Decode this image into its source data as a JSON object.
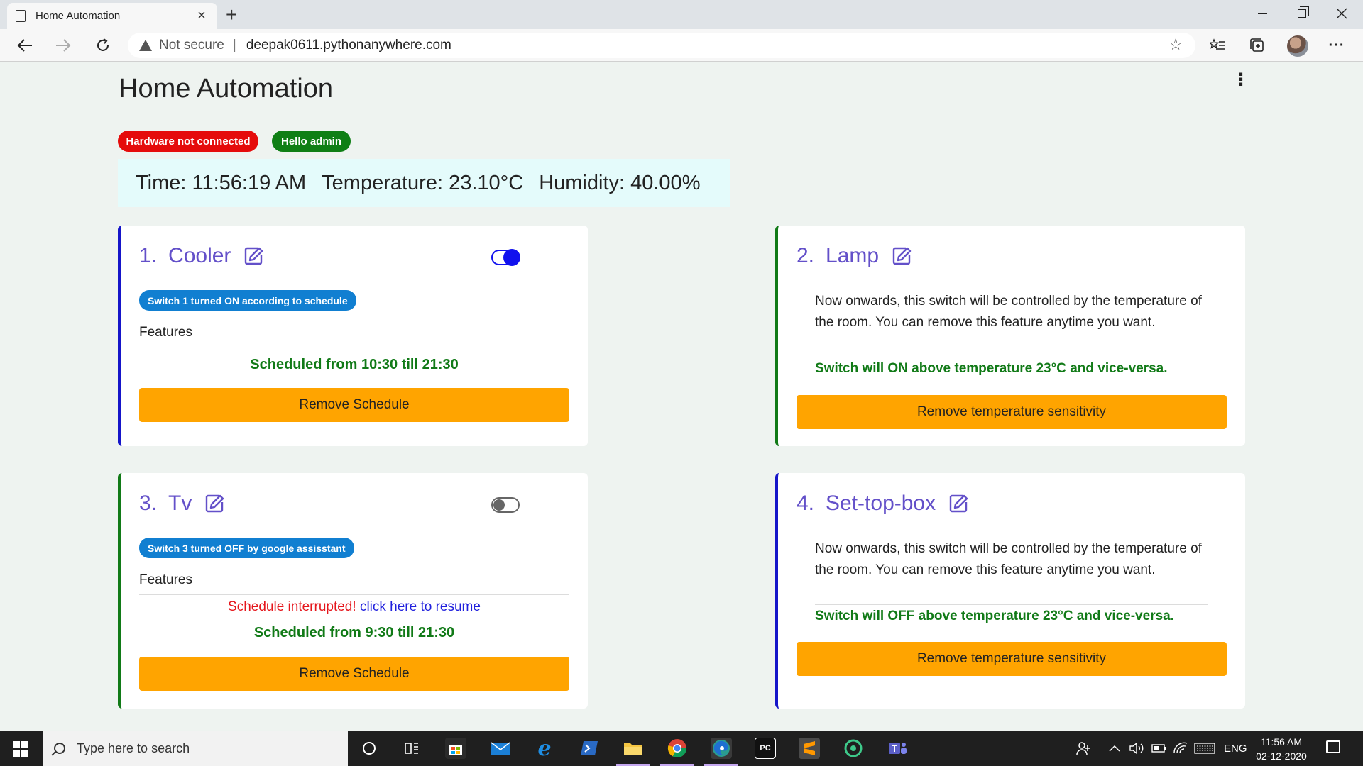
{
  "browser": {
    "tab_title": "Home Automation",
    "tab_close": "×",
    "new_tab": "+",
    "not_secure": "Not secure",
    "separator": "|",
    "url": "deepak0611.pythonanywhere.com"
  },
  "page": {
    "title": "Home Automation",
    "badges": {
      "hardware": "Hardware not connected",
      "hello": "Hello admin"
    },
    "sensors": {
      "time": "Time: 11:56:19 AM",
      "temperature": "Temperature: 23.10°C",
      "humidity": "Humidity: 40.00%"
    },
    "features_label": "Features",
    "cards": [
      {
        "number": "1.",
        "name": "Cooler",
        "toggle": "on",
        "status": "Switch 1 turned ON according to schedule",
        "schedule": "Scheduled from 10:30 till 21:30",
        "button": "Remove Schedule"
      },
      {
        "number": "2.",
        "name": "Lamp",
        "description": "Now onwards, this switch will be controlled by the temperature of the room. You can remove this feature anytime you want.",
        "result": "Switch will ON above temperature 23°C and vice-versa.",
        "button": "Remove temperature sensitivity"
      },
      {
        "number": "3.",
        "name": "Tv",
        "toggle": "off",
        "status": "Switch 3 turned OFF by google assisstant",
        "interrupted": "Schedule interrupted!",
        "resume_link": "click here to resume",
        "schedule": "Scheduled from 9:30 till 21:30",
        "button": "Remove Schedule"
      },
      {
        "number": "4.",
        "name": "Set-top-box",
        "description": "Now onwards, this switch will be controlled by the temperature of the room. You can remove this feature anytime you want.",
        "result": "Switch will OFF above temperature 23°C and vice-versa.",
        "button": "Remove temperature sensitivity"
      }
    ]
  },
  "taskbar": {
    "search_placeholder": "Type here to search",
    "language": "ENG",
    "time": "11:56 AM",
    "date": "02-12-2020"
  },
  "colors": {
    "accent_purple": "#6350c9",
    "badge_red": "#e50b0b",
    "badge_green": "#0f7f15",
    "status_blue": "#117fd1",
    "button_orange": "#ffa400",
    "card_border_blue": "#1515c9",
    "card_border_green": "#117a17"
  }
}
